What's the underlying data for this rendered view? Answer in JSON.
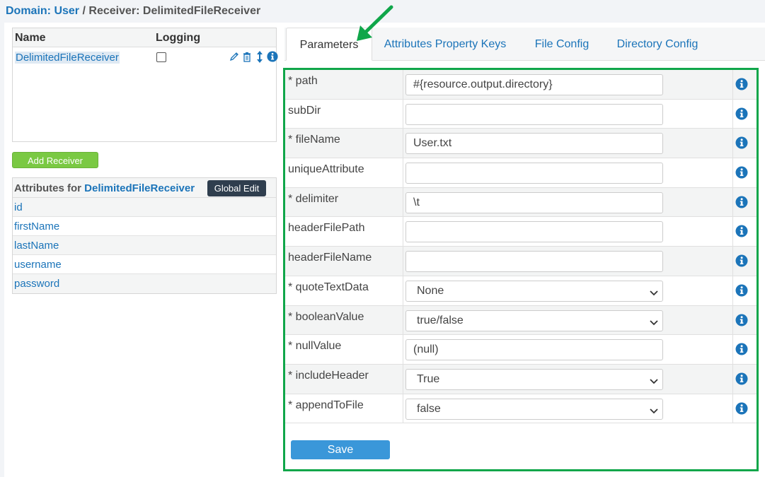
{
  "breadcrumb": {
    "domain_label": "Domain:",
    "domain_value": "User",
    "separator": "/",
    "receiver_label": "Receiver:",
    "receiver_value": "DelimitedFileReceiver"
  },
  "receivers": {
    "col_name": "Name",
    "col_logging": "Logging",
    "rows": [
      {
        "name": "DelimitedFileReceiver",
        "logging": false
      }
    ]
  },
  "add_receiver_label": "Add Receiver",
  "attributes": {
    "title_prefix": "Attributes for",
    "title_receiver": "DelimitedFileReceiver",
    "global_edit_label": "Global Edit",
    "items": [
      "id",
      "firstName",
      "lastName",
      "username",
      "password"
    ]
  },
  "tabs": [
    {
      "label": "Parameters",
      "active": true
    },
    {
      "label": "Attributes Property Keys",
      "active": false
    },
    {
      "label": "File Config",
      "active": false
    },
    {
      "label": "Directory Config",
      "active": false
    }
  ],
  "parameters": [
    {
      "label": "* path",
      "type": "input",
      "value": "#{resource.output.directory}"
    },
    {
      "label": "subDir",
      "type": "input",
      "value": ""
    },
    {
      "label": "* fileName",
      "type": "input",
      "value": "User.txt"
    },
    {
      "label": "uniqueAttribute",
      "type": "input",
      "value": ""
    },
    {
      "label": "* delimiter",
      "type": "input",
      "value": "\\t"
    },
    {
      "label": "headerFilePath",
      "type": "input",
      "value": ""
    },
    {
      "label": "headerFileName",
      "type": "input",
      "value": ""
    },
    {
      "label": "* quoteTextData",
      "type": "select",
      "value": "None"
    },
    {
      "label": "* booleanValue",
      "type": "select",
      "value": "true/false"
    },
    {
      "label": "* nullValue",
      "type": "input",
      "value": "(null)"
    },
    {
      "label": "* includeHeader",
      "type": "select",
      "value": "True"
    },
    {
      "label": "* appendToFile",
      "type": "select",
      "value": "false"
    }
  ],
  "save_label": "Save",
  "colors": {
    "link": "#1b74b9",
    "highlight": "#10a64a",
    "save": "#3a97d9",
    "add": "#7ac943",
    "global_edit": "#2f3e4e"
  },
  "icons": {
    "row_actions": [
      "pencil-icon",
      "trash-icon",
      "sort-arrows-icon",
      "info-icon"
    ],
    "param_info": "info-icon",
    "annotation": "green-arrow"
  }
}
